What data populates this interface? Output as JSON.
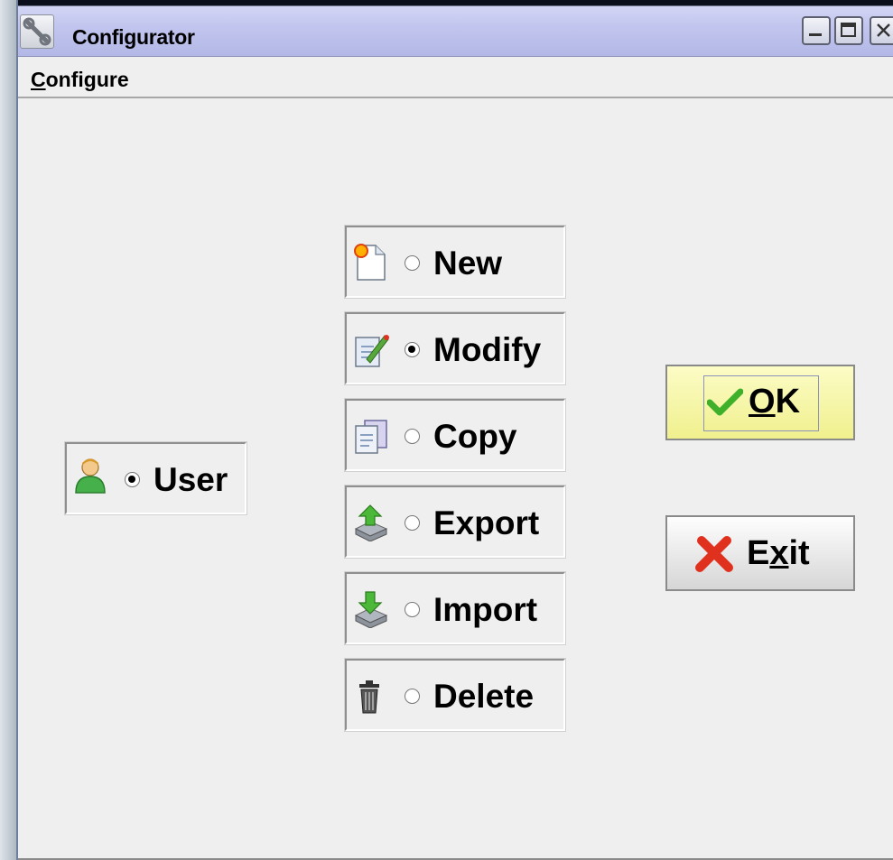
{
  "window": {
    "title": "Configurator"
  },
  "menubar": {
    "items": [
      {
        "label": "Configure",
        "mnemonic": "C",
        "rest": "onfigure"
      }
    ]
  },
  "subject": {
    "label": "User",
    "selected": true,
    "icon": "user-icon"
  },
  "actions": [
    {
      "label": "New",
      "selected": false,
      "icon": "new-document-icon"
    },
    {
      "label": "Modify",
      "selected": true,
      "icon": "edit-document-icon"
    },
    {
      "label": "Copy",
      "selected": false,
      "icon": "copy-document-icon"
    },
    {
      "label": "Export",
      "selected": false,
      "icon": "export-icon"
    },
    {
      "label": "Import",
      "selected": false,
      "icon": "import-icon"
    },
    {
      "label": "Delete",
      "selected": false,
      "icon": "trash-icon"
    }
  ],
  "buttons": {
    "ok": {
      "label": "OK",
      "mnemonic": "O",
      "rest": "K",
      "icon": "checkmark-icon"
    },
    "exit": {
      "label": "Exit",
      "pre": "E",
      "mnemonic": "x",
      "post": "it",
      "icon": "x-icon"
    }
  },
  "colors": {
    "titlebar": "#c1c5ee",
    "ok_button": "#f6f6a8",
    "check": "#3fb02a",
    "x_red": "#e0301e"
  }
}
